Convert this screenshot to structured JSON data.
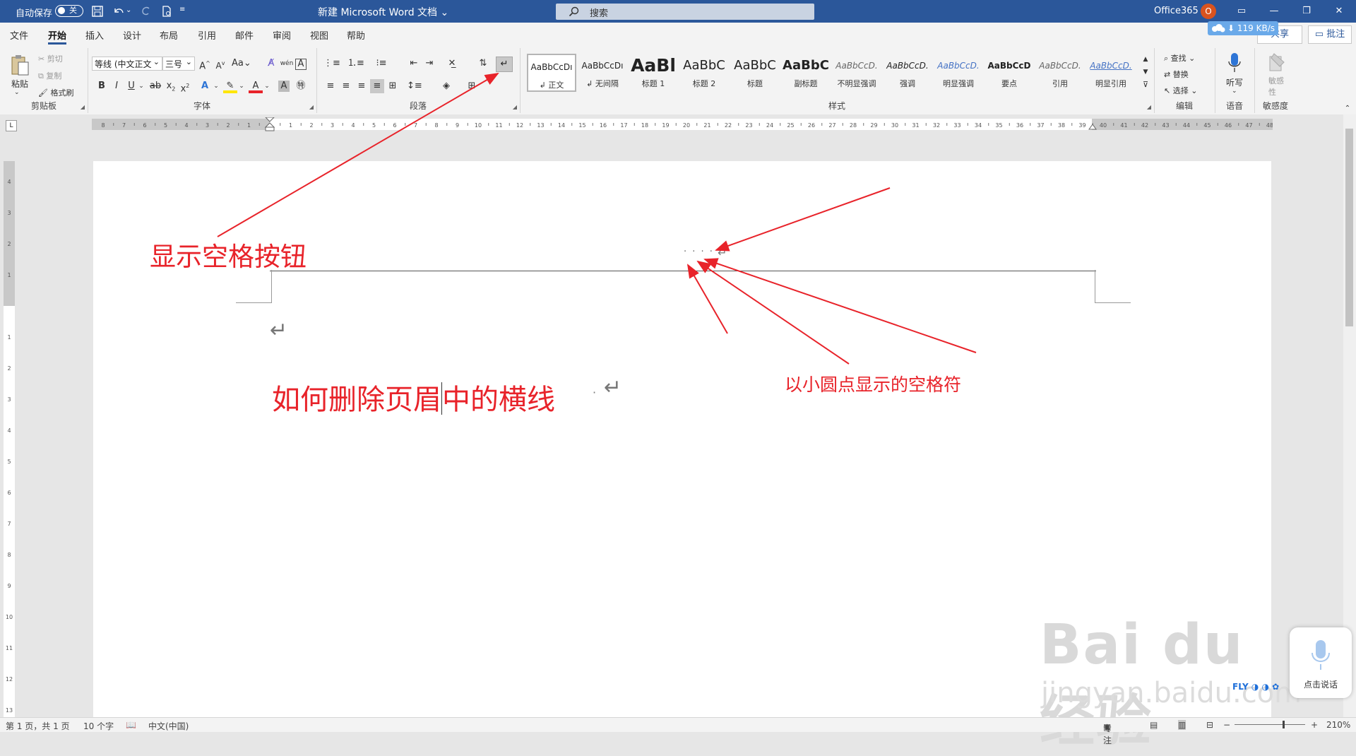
{
  "titlebar": {
    "autosave_label": "自动保存",
    "autosave_state": "关",
    "doc_title": "新建 Microsoft Word 文档 ⌄",
    "search_placeholder": "搜索",
    "account": "Office365",
    "avatar_initial": "O",
    "speed": "119 KB/s",
    "bg_color": "#2b579a"
  },
  "menu": {
    "tabs": [
      "文件",
      "开始",
      "插入",
      "设计",
      "布局",
      "引用",
      "邮件",
      "审阅",
      "视图",
      "帮助"
    ],
    "active": "开始",
    "share": "共享",
    "comment": "批注"
  },
  "ribbon": {
    "clipboard": {
      "paste": "粘贴",
      "cut": "剪切",
      "copy": "复制",
      "format_painter": "格式刷",
      "label": "剪贴板"
    },
    "font": {
      "font_name": "等线 (中文正文",
      "font_size": "三号",
      "label": "字体"
    },
    "paragraph": {
      "label": "段落"
    },
    "styles": {
      "label": "样式",
      "items": [
        {
          "preview": "AaBbCcDı",
          "name": "↲ 正文"
        },
        {
          "preview": "AaBbCcDı",
          "name": "↲ 无间隔"
        },
        {
          "preview": "AaBl",
          "name": "标题 1"
        },
        {
          "preview": "AaBbC",
          "name": "标题 2"
        },
        {
          "preview": "AaBbC",
          "name": "标题"
        },
        {
          "preview": "AaBbC",
          "name": "副标题"
        },
        {
          "preview": "AaBbCcD.",
          "name": "不明显强调"
        },
        {
          "preview": "AaBbCcD.",
          "name": "强调"
        },
        {
          "preview": "AaBbCcD.",
          "name": "明显强调"
        },
        {
          "preview": "AaBbCcD",
          "name": "要点"
        },
        {
          "preview": "AaBbCcD.",
          "name": "引用"
        },
        {
          "preview": "AaBbCcD.",
          "name": "明显引用"
        }
      ]
    },
    "editing": {
      "find": "查找",
      "replace": "替换",
      "select": "选择",
      "label": "编辑"
    },
    "voice": {
      "dictate": "听写",
      "label": "语音"
    },
    "sensitivity": {
      "btn": "敏感性",
      "label": "敏感度"
    }
  },
  "document": {
    "annotation_button": "显示空格按钮",
    "annotation_dots": "以小圆点显示的空格符",
    "body_text_before": "如何删除页眉",
    "body_text_after": "中的横线",
    "paragraph_mark": "↵",
    "space_dots": "· · · ·",
    "annotation_color": "#e8232a"
  },
  "watermark": {
    "brand": "Bai du 经验",
    "url": "jingyan.baidu.com"
  },
  "voice_widget": {
    "label": "点击说话"
  },
  "status": {
    "page": "第 1 页，共 1 页",
    "words": "10 个字",
    "lang": "中文(中国)",
    "focus": "专注",
    "zoom": "210%"
  }
}
